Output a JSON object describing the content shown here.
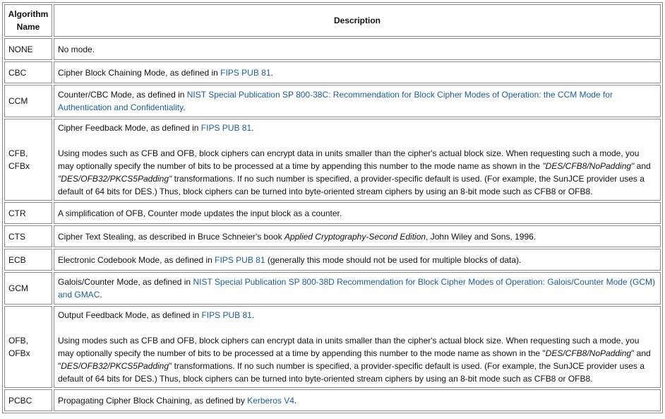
{
  "table": {
    "headers": {
      "name": "Algorithm Name",
      "description": "Description"
    },
    "rows": {
      "none": {
        "name": "NONE",
        "desc": "No mode."
      },
      "cbc": {
        "name": "CBC",
        "pre": "Cipher Block Chaining Mode, as defined in ",
        "link": "FIPS PUB 81",
        "post": "."
      },
      "ccm": {
        "name": "CCM",
        "pre": "Counter/CBC Mode, as defined in ",
        "link": "NIST Special Publication SP 800-38C: Recommendation for Block Cipher Modes of Operation: the CCM Mode for Authentication and Confidentiality",
        "post": "."
      },
      "cfb": {
        "name_line1": "CFB,",
        "name_line2": "CFBx",
        "pre": "Cipher Feedback Mode, as defined in ",
        "link": "FIPS PUB 81",
        "post": ".",
        "body1": "Using modes such as CFB and OFB, block ciphers can encrypt data in units smaller than the cipher's actual block size. When requesting such a mode, you may optionally specify the number of bits to be processed at a time by appending this number to the mode name as shown in the ",
        "example1": "\"DES/CFB8/NoPadding\"",
        "and": " and ",
        "example2": "\"DES/OFB32/PKCS5Padding\"",
        "body2": " transformations. If no such number is specified, a provider-specific default is used. (For example, the SunJCE provider uses a default of 64 bits for DES.) Thus, block ciphers can be turned into byte-oriented stream ciphers by using an 8-bit mode such as CFB8 or OFB8."
      },
      "ctr": {
        "name": "CTR",
        "desc": "A simplification of OFB, Counter mode updates the input block as a counter."
      },
      "cts": {
        "name": "CTS",
        "pre": "Cipher Text Stealing, as described in Bruce Schneier's book ",
        "book": "Applied Cryptography-Second Edition",
        "post": ", John Wiley and Sons, 1996."
      },
      "ecb": {
        "name": "ECB",
        "pre": "Electronic Codebook Mode, as defined in ",
        "link": "FIPS PUB 81",
        "post": " (generally this mode should not be used for multiple blocks of data)."
      },
      "gcm": {
        "name": "GCM",
        "pre": "Galois/Counter Mode, as defined in ",
        "link": "NIST Special Publication SP 800-38D Recommendation for Block Cipher Modes of Operation: Galois/Counter Mode (GCM) and GMAC",
        "post": "."
      },
      "ofb": {
        "name_line1": "OFB,",
        "name_line2": "OFBx",
        "pre": "Output Feedback Mode, as defined in ",
        "link": "FIPS PUB 81",
        "post": ".",
        "body1": "Using modes such as CFB and OFB, block ciphers can encrypt data in units smaller than the cipher's actual block size. When requesting such a mode, you may optionally specify the number of bits to be processed at a time by appending this number to the mode name as shown in the \"",
        "example1": "DES/CFB8/NoPadding",
        "and": "\" and \"",
        "example2": "DES/OFB32/PKCS5Padding",
        "body2": "\" transformations. If no such number is specified, a provider-specific default is used. (For example, the SunJCE provider uses a default of 64 bits for DES.) Thus, block ciphers can be turned into byte-oriented stream ciphers by using an 8-bit mode such as CFB8 or OFB8."
      },
      "pcbc": {
        "name": "PCBC",
        "pre": "Propagating Cipher Block Chaining, as defined by ",
        "link": "Kerberos V4",
        "post": "."
      }
    }
  },
  "colors": {
    "link": "#1a5c9e",
    "border": "#8a8a8a"
  }
}
